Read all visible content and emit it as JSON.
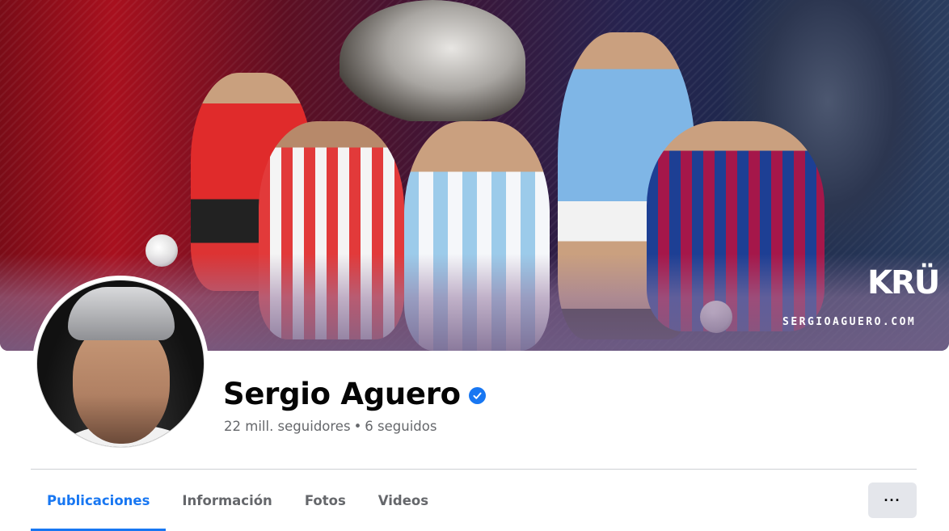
{
  "cover": {
    "brand_logo_text": "KRÜ",
    "brand_site": "SERGIOAGUERO.COM"
  },
  "profile": {
    "name": "Sergio Aguero",
    "verified": true,
    "followers": "22 mill. seguidores",
    "separator": "•",
    "following": "6 seguidos"
  },
  "tabs": [
    {
      "label": "Publicaciones",
      "active": true
    },
    {
      "label": "Información",
      "active": false
    },
    {
      "label": "Fotos",
      "active": false
    },
    {
      "label": "Videos",
      "active": false
    }
  ],
  "more_button": {
    "label": "···",
    "icon": "more-horizontal-icon"
  },
  "colors": {
    "accent": "#1877f2",
    "text_primary": "#050505",
    "text_secondary": "#65676b",
    "button_bg": "#e4e6eb"
  }
}
